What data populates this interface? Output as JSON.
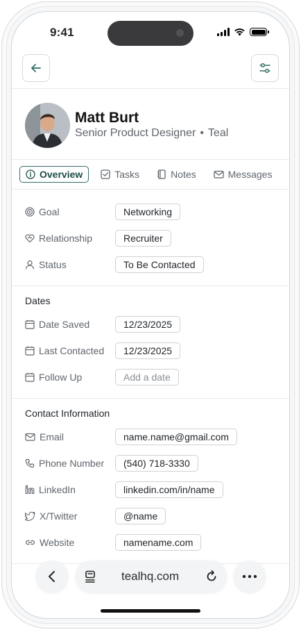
{
  "status_bar": {
    "time": "9:41"
  },
  "profile": {
    "name": "Matt Burt",
    "title": "Senior Product Designer",
    "separator": "•",
    "company": "Teal"
  },
  "tabs": [
    {
      "label": "Overview",
      "icon": "info-icon",
      "active": true
    },
    {
      "label": "Tasks",
      "icon": "checkbox-icon",
      "active": false
    },
    {
      "label": "Notes",
      "icon": "notebook-icon",
      "active": false
    },
    {
      "label": "Messages",
      "icon": "mail-icon",
      "active": false
    }
  ],
  "overview": {
    "goal": {
      "label": "Goal",
      "value": "Networking"
    },
    "relationship": {
      "label": "Relationship",
      "value": "Recruiter"
    },
    "status": {
      "label": "Status",
      "value": "To Be Contacted"
    }
  },
  "dates": {
    "title": "Dates",
    "date_saved": {
      "label": "Date Saved",
      "value": "12/23/2025"
    },
    "last_contacted": {
      "label": "Last Contacted",
      "value": "12/23/2025"
    },
    "follow_up": {
      "label": "Follow Up",
      "placeholder": "Add a date"
    }
  },
  "contact": {
    "title": "Contact Information",
    "email": {
      "label": "Email",
      "value": "name.name@gmail.com"
    },
    "phone": {
      "label": "Phone Number",
      "value": "(540) 718-3330"
    },
    "linkedin": {
      "label": "LinkedIn",
      "value": "linkedin.com/in/name"
    },
    "twitter": {
      "label": "X/Twitter",
      "value": "@name"
    },
    "website": {
      "label": "Website",
      "value": "namename.com"
    }
  },
  "browser": {
    "url": "tealhq.com"
  },
  "colors": {
    "accent": "#2f6f66",
    "border": "#cdd1d5",
    "muted_text": "#5f656c"
  }
}
